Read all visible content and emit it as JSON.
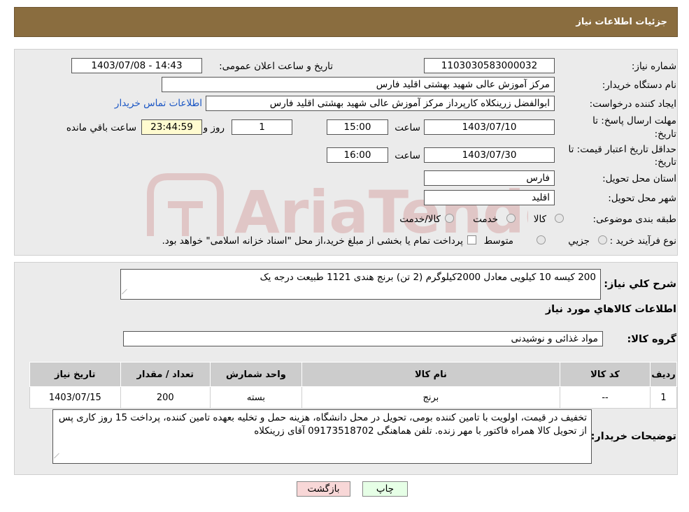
{
  "header": {
    "title": "جزئیات اطلاعات نیاز"
  },
  "fields": {
    "need_number_label": "شماره نیاز:",
    "need_number": "1103030583000032",
    "announce_label": "تاریخ و ساعت اعلان عمومی:",
    "announce_value": "1403/07/08 - 14:43",
    "buyer_org_label": "نام دستگاه خریدار:",
    "buyer_org": "مرکز آموزش عالی شهید بهشتی اقلید فارس",
    "requester_label": "ایجاد کننده درخواست:",
    "requester": "ابوالفضل زرینکلاه کارپرداز مرکز آموزش عالی شهید بهشتی اقلید فارس",
    "contact_link": "اطلاعات تماس خریدار",
    "deadline_label_1": "مهلت ارسال پاسخ: تا",
    "deadline_label_2": "تاریخ:",
    "deadline_date": "1403/07/10",
    "time_word": "ساعت",
    "deadline_time": "15:00",
    "days_value": "1",
    "days_word": "روز و",
    "remaining_time": "23:44:59",
    "remaining_word": "ساعت باقي مانده",
    "validity_label_1": "حداقل تاریخ اعتبار قیمت: تا",
    "validity_label_2": "تاریخ:",
    "validity_date": "1403/07/30",
    "validity_time": "16:00",
    "province_label": "استان محل تحویل:",
    "province": "فارس",
    "city_label": "شهر محل تحویل:",
    "city": "اقلید",
    "category_label": "طبقه بندی موضوعی:",
    "category_options": [
      "کالا",
      "خدمت",
      "کالا/خدمت"
    ],
    "process_label": "نوع فرآیند خرید :",
    "process_options": [
      "جزیي",
      "متوسط"
    ],
    "payment_note": "پرداخت تمام یا بخشی از مبلغ خرید،از محل \"اسناد خزانه اسلامی\" خواهد بود."
  },
  "summary": {
    "label": "شرح کلي نياز:",
    "text": "200 کیسه 10 کیلویی معادل 2000کیلوگرم (2 تن) برنج هندی 1121 طبیعت درجه یک"
  },
  "goods": {
    "section_title": "اطلاعات کالاهاي مورد نياز",
    "group_label": "گروه کالا:",
    "group_value": "مواد غذائی و نوشیدنی"
  },
  "table": {
    "headers": [
      "رديف",
      "کد کالا",
      "نام کالا",
      "واحد شمارش",
      "تعداد / مقدار",
      "تاريخ نياز"
    ],
    "rows": [
      [
        "1",
        "--",
        "برنج",
        "بسته",
        "200",
        "1403/07/15"
      ]
    ]
  },
  "buyer_notes": {
    "label": "توضیحات خریدار:",
    "text": "تخفیف در قیمت، اولویت با تامین کننده بومی، تحویل در محل دانشگاه، هزینه حمل و تخلیه بعهده تامین کننده، پرداخت 15 روز کاری پس از تحویل کالا همراه فاکتور با مهر زنده. تلفن هماهنگی 09173518702 آقای زرینکلاه"
  },
  "buttons": {
    "print": "چاپ",
    "back": "بازگشت"
  },
  "watermark": {
    "text": "AriaTender.neT"
  },
  "colors": {
    "header_bg": "#8a6d3f",
    "panel_bg": "#ebebeb",
    "link": "#1a56c4",
    "back_btn_bg": "#f8d7d7"
  }
}
